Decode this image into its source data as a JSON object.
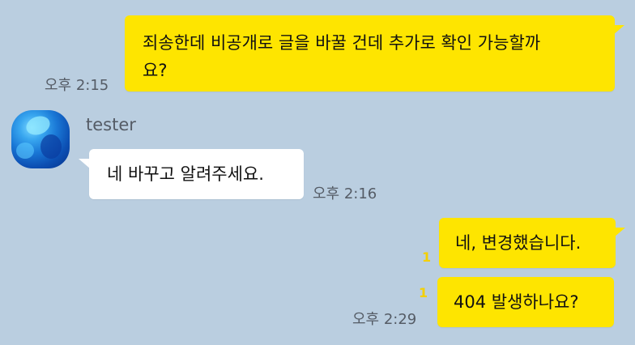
{
  "messages": [
    {
      "sender": "me",
      "lines": [
        "죄송한데 비공개로 글을 바꿀 건데 추가로 확인 가능할까",
        "요?"
      ],
      "time": "오후 2:15"
    },
    {
      "sender": "tester",
      "sender_name": "tester",
      "text": "네 바꾸고 알려주세요.",
      "time": "오후 2:16"
    },
    {
      "sender": "me",
      "text": "네, 변경했습니다.",
      "unread": "1"
    },
    {
      "sender": "me",
      "text": "404 발생하나요?",
      "unread": "1",
      "time": "오후 2:29"
    }
  ],
  "colors": {
    "background": "#bacee0",
    "my_bubble": "#fee500",
    "other_bubble": "#ffffff",
    "unread": "#f4d000"
  },
  "icons": {
    "avatar": "profile-avatar-blue"
  }
}
